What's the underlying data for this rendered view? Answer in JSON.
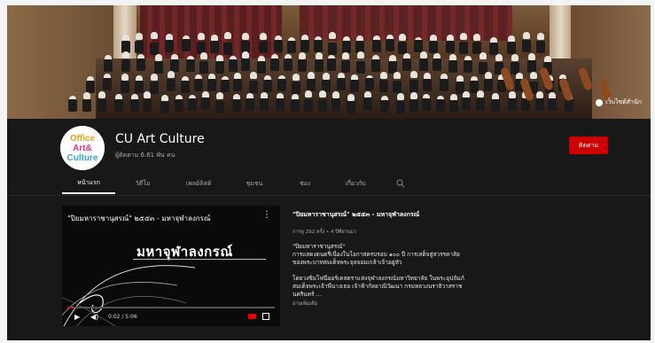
{
  "banner": {
    "link_label": "เว็บไซต์สำนัก"
  },
  "channel": {
    "name": "CU Art Culture",
    "subscribers": "ผู้ติดตาม 6.61 พัน คน",
    "subscribe_label": "ติดตาม",
    "avatar_lines": [
      "Office",
      "Art&",
      "Culture"
    ]
  },
  "tabs": [
    {
      "label": "หน้าแรก",
      "active": true
    },
    {
      "label": "วิดีโอ",
      "active": false
    },
    {
      "label": "เพลย์ลิสต์",
      "active": false
    },
    {
      "label": "ชุมชน",
      "active": false
    },
    {
      "label": "ช่อง",
      "active": false
    },
    {
      "label": "เกี่ยวกับ",
      "active": false
    }
  ],
  "video": {
    "title": "\"ปิยมหาราชานุสรณ์\" ๒๕๕๓ - มหาจุฬาลงกรณ์",
    "overlay_title": "มหาจุฬาลงกรณ์",
    "time": "0:02 / 5:06",
    "progress": 0.01
  },
  "details": {
    "title": "\"ปิยมหาราชานุสรณ์\" ๒๕๕๓ - มหาจุฬาลงกรณ์",
    "meta": "การดู 292 ครั้ง • 4 ปีที่ผ่านมา",
    "lines": [
      "\"ปิยมหาราชานุสรณ์\"",
      "การแสดงดนตรีเนื่องในโอกาสครบรอบ ๑๐๐ ปี การเสด็จสู่สวรรคาลัย",
      "ของพระบาทสมเด็จพระจุลจอมเกล้าเจ้าอยู่หัว",
      "",
      "โดยวงซิมโฟนีออร์เคสตราแห่งจุฬาลงกรณ์มหาวิทยาลัย ในพระอุปถัมภ์",
      "สมเด็จพระเจ้าพี่นางเธอ เจ้าฟ้ากัลยาณิวัฒนา กรมหลวงนราธิวาสราช",
      "นครินทร์ ..."
    ],
    "more_label": "อ่านเพิ่มเติม"
  },
  "colors": {
    "background": "#181818",
    "accent": "#cc0000",
    "text": "#ffffff",
    "muted": "#aaaaaa"
  }
}
